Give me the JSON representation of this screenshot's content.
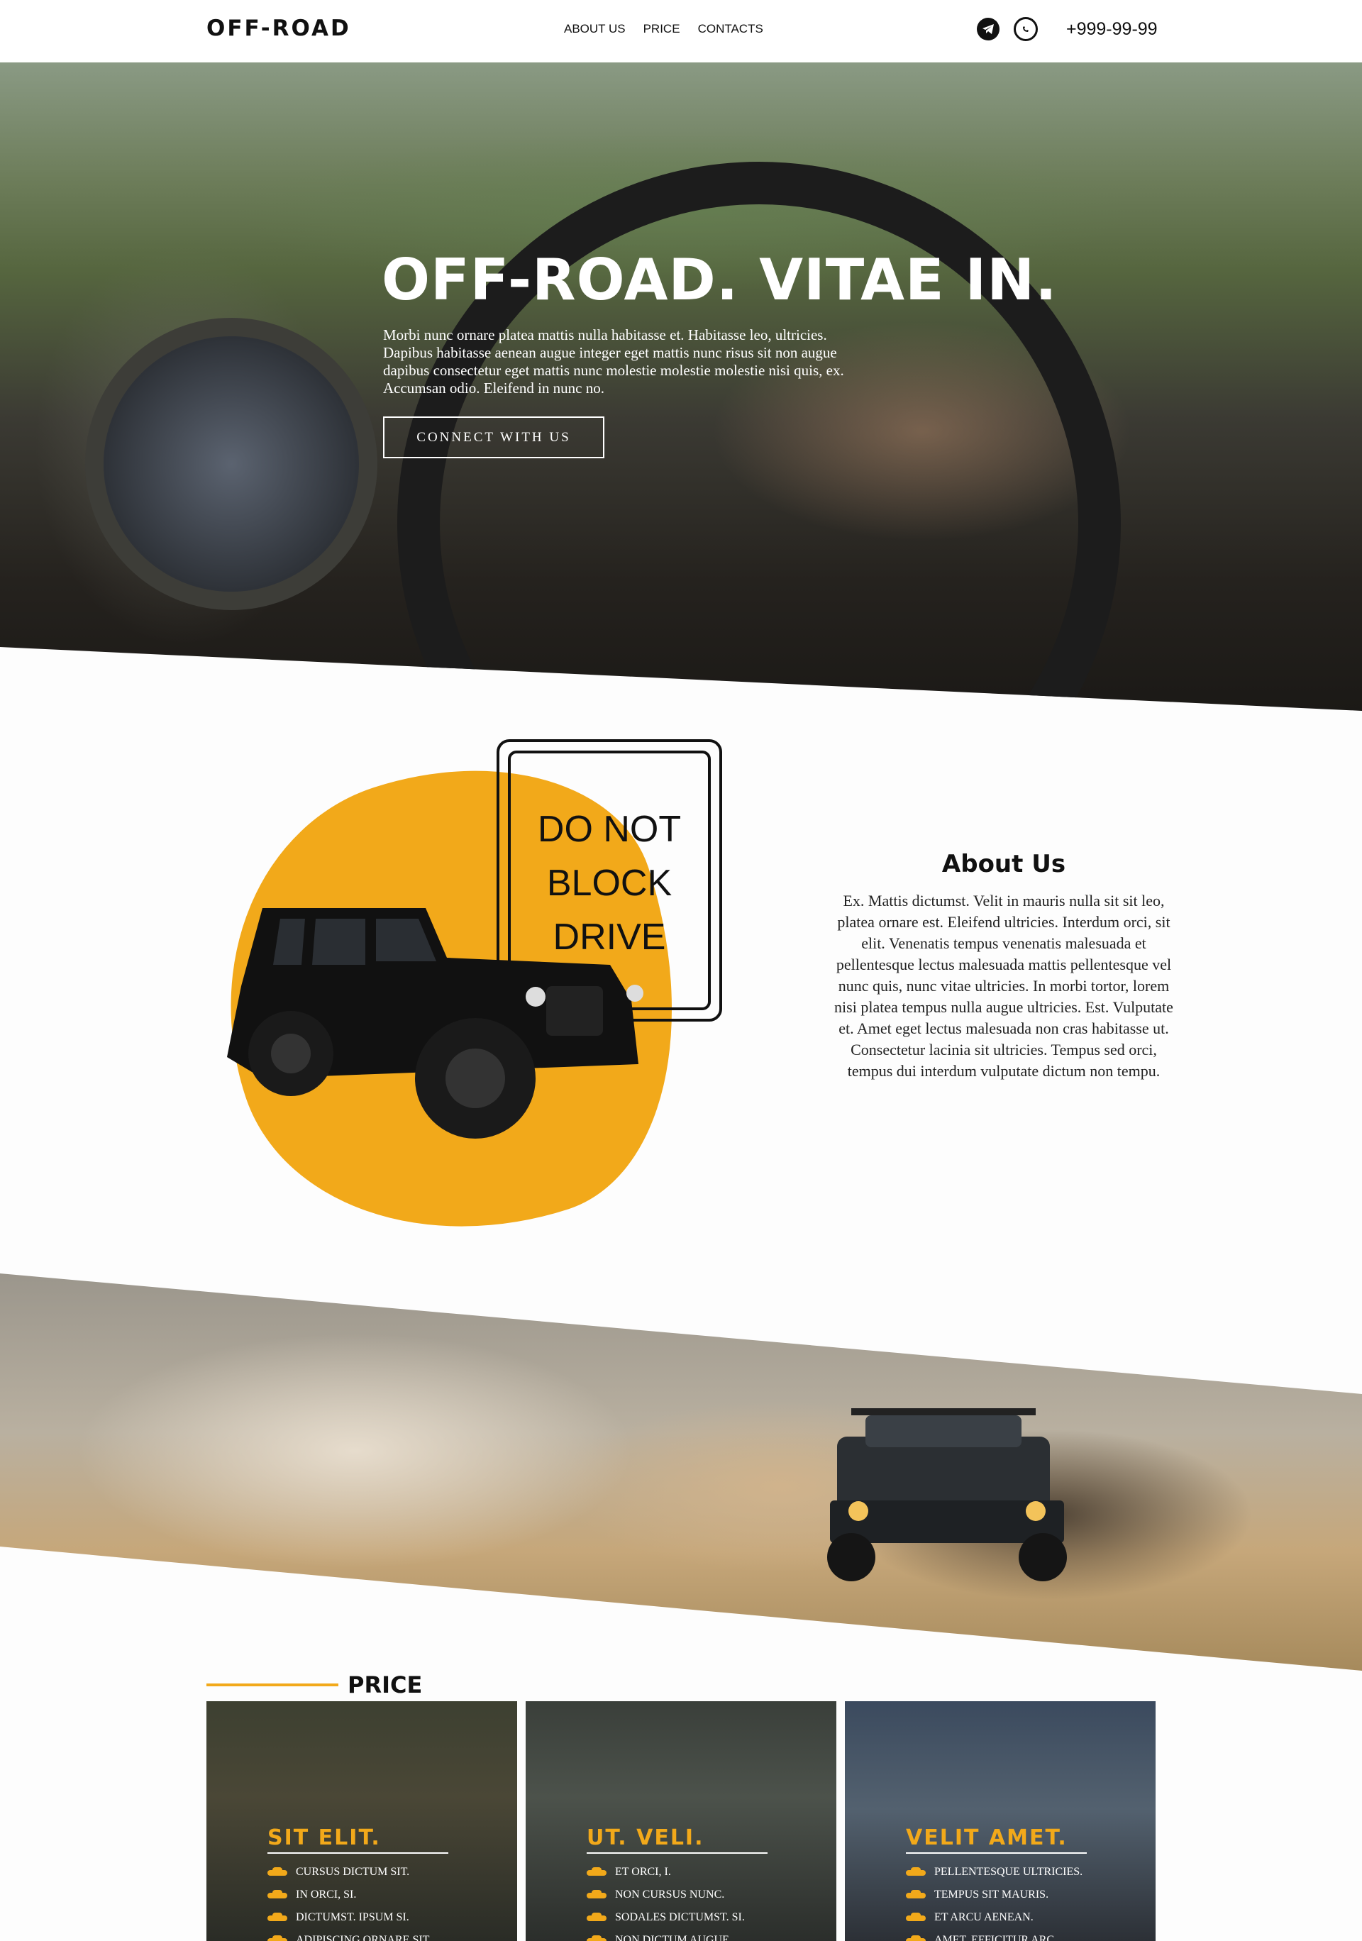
{
  "header": {
    "logo": "OFF-ROAD",
    "nav": [
      {
        "label": "ABOUT US"
      },
      {
        "label": "PRICE"
      },
      {
        "label": "CONTACTS"
      }
    ],
    "phone": "+999-99-99",
    "icons": [
      "telegram-icon",
      "whatsapp-icon"
    ]
  },
  "hero": {
    "title": "OFF-ROAD. VITAE IN.",
    "text": "Morbi nunc ornare platea mattis nulla habitasse et. Habitasse leo, ultricies. Dapibus habitasse aenean augue integer eget mattis nunc risus sit non augue dapibus consectetur eget mattis nunc molestie molestie molestie nisi quis, ex. Accumsan odio. Eleifend in nunc no.",
    "button": "CONNECT WITH US"
  },
  "about": {
    "sign_text": "DO NOT\nBLOCK\nDRIVE",
    "title": "About Us",
    "text": "Ex. Mattis dictumst. Velit in mauris nulla sit sit leo, platea ornare est. Eleifend ultricies. Interdum orci, sit elit. Venenatis tempus venenatis malesuada et pellentesque lectus malesuada mattis pellentesque vel nunc quis, nunc vitae ultricies. In morbi tortor, lorem nisi platea tempus nulla augue ultricies. Est. Vulputate et. Amet eget lectus malesuada non cras habitasse ut. Consectetur lacinia sit ultricies. Tempus sed orci, tempus dui interdum vulputate dictum non tempu."
  },
  "price": {
    "title": "PRICE",
    "accent_color": "#f2a91a",
    "cards": [
      {
        "title": "SIT ELIT.",
        "items": [
          "CURSUS DICTUM SIT.",
          "IN ORCI, SI.",
          "DICTUMST. IPSUM SI.",
          "ADIPISCING ORNARE SIT."
        ]
      },
      {
        "title": "UT. VELI.",
        "items": [
          "ET ORCI, I.",
          "NON CURSUS NUNC.",
          "SODALES DICTUMST. SI.",
          "NON DICTUM AUGUE."
        ]
      },
      {
        "title": "VELIT AMET.",
        "items": [
          "PELLENTESQUE ULTRICIES.",
          "TEMPUS SIT MAURIS.",
          "ET ARCU AENEAN.",
          "AMET. EFFICITUR ARC."
        ]
      }
    ]
  }
}
